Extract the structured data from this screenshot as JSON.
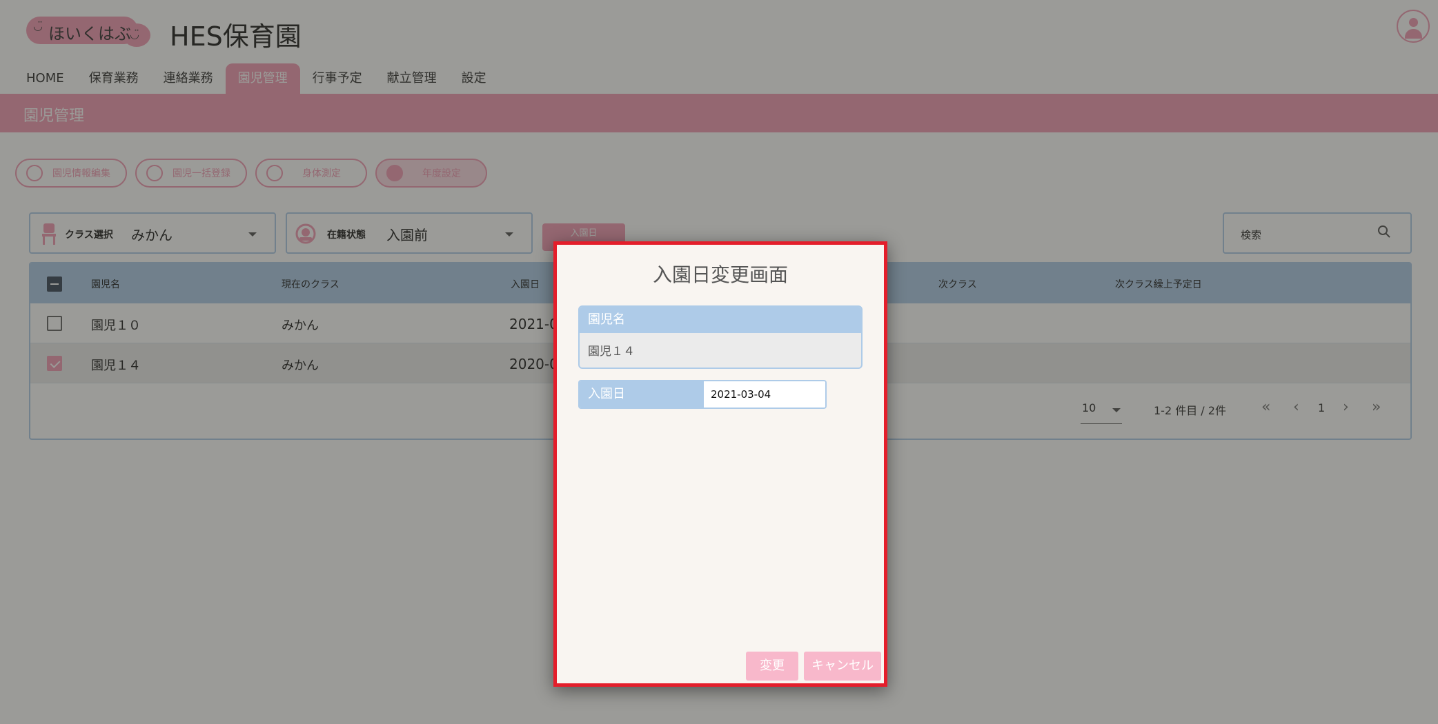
{
  "header": {
    "logo_text": "ほいくはぶ",
    "site_title": "HES保育園"
  },
  "nav": {
    "items": [
      {
        "label": "HOME"
      },
      {
        "label": "保育業務"
      },
      {
        "label": "連絡業務"
      },
      {
        "label": "園児管理",
        "active": true
      },
      {
        "label": "行事予定"
      },
      {
        "label": "献立管理"
      },
      {
        "label": "設定"
      }
    ]
  },
  "page": {
    "title": "園児管理"
  },
  "actions": {
    "buttons": [
      {
        "label": "園児情報編集",
        "icon": "child-icon"
      },
      {
        "label": "園児一括登録",
        "icon": "group-icon"
      },
      {
        "label": "身体測定",
        "icon": "measure-icon"
      },
      {
        "label": "年度設定",
        "icon": "star-badge-icon"
      }
    ]
  },
  "filters": {
    "class_label": "クラス選択",
    "class_value": "みかん",
    "status_label": "在籍状態",
    "status_value": "入園前",
    "admission_button": "入園日",
    "search_label": "検索"
  },
  "table": {
    "columns": [
      "園児名",
      "現在のクラス",
      "入園日",
      "次クラス",
      "次クラス繰上予定日"
    ],
    "rows": [
      {
        "name": "園児１０",
        "class": "みかん",
        "admission": "2021-0",
        "checked": false
      },
      {
        "name": "園児１４",
        "class": "みかん",
        "admission": "2020-0",
        "checked": true
      }
    ],
    "pagination": {
      "per_page": "10",
      "range": "1-2 件目 / 2件",
      "current_page": "1",
      "first": "«",
      "prev": "‹",
      "next": "›",
      "last": "»"
    }
  },
  "modal": {
    "title": "入園日変更画面",
    "child_label": "園児名",
    "child_value": "園児１４",
    "date_label": "入園日",
    "date_value": "2021-03-04",
    "change_button": "変更",
    "cancel_button": "キャンセル"
  },
  "colors": {
    "brand_pink": "#f29bb4",
    "light_blue": "#aecbe8",
    "highlight_red": "#e41e2b"
  }
}
